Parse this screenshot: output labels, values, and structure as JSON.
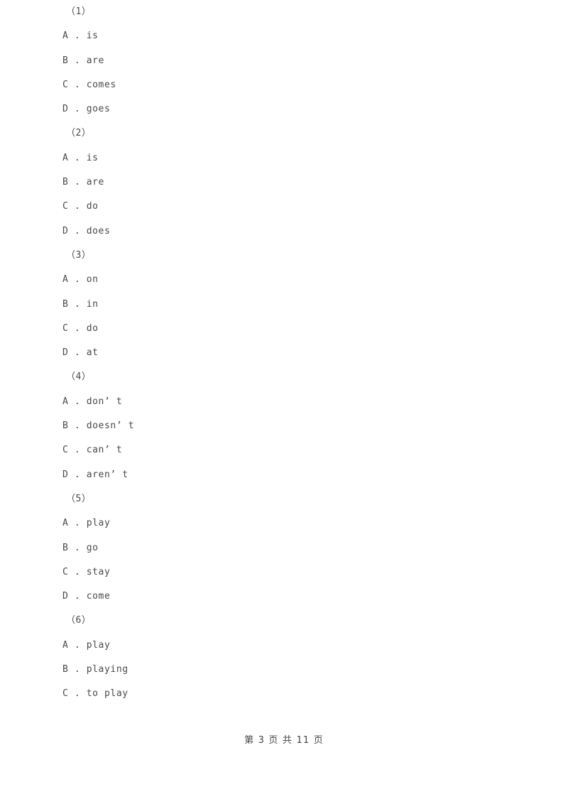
{
  "document": {
    "background_color": "#ffffff",
    "text_color": "#4a4a4a"
  },
  "questions": [
    {
      "number": "（1）",
      "options": [
        "A . is",
        "B . are",
        "C . comes",
        "D . goes"
      ]
    },
    {
      "number": "（2）",
      "options": [
        "A . is",
        "B . are",
        "C . do",
        "D . does"
      ]
    },
    {
      "number": "（3）",
      "options": [
        "A . on",
        "B . in",
        "C . do",
        "D . at"
      ]
    },
    {
      "number": "（4）",
      "options": [
        "A . don’ t",
        "B . doesn’ t",
        "C . can’ t",
        "D . aren’ t"
      ]
    },
    {
      "number": "（5）",
      "options": [
        "A . play",
        "B . go",
        "C . stay",
        "D . come"
      ]
    },
    {
      "number": "（6）",
      "options": [
        "A . play",
        "B . playing",
        "C . to play"
      ]
    }
  ],
  "footer": {
    "text": "第 3 页 共 11 页",
    "current_page": "3",
    "total_pages": "11"
  }
}
